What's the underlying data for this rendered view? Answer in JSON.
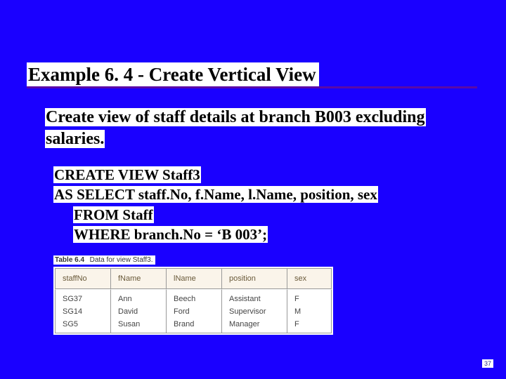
{
  "title": "Example 6. 4 - Create Vertical View",
  "description": "Create view of staff details at branch B003 excluding salaries.",
  "sql": {
    "line1": "CREATE VIEW Staff3",
    "line2": "AS SELECT staff.No, f.Name, l.Name, position, sex",
    "line3": "FROM Staff",
    "line4": "WHERE branch.No = ‘B 003’;"
  },
  "table_caption_bold": "Table 6.4",
  "table_caption_rest": "Data for view Staff3.",
  "chart_data": {
    "type": "table",
    "headers": [
      "staffNo",
      "fName",
      "lName",
      "position",
      "sex"
    ],
    "rows": [
      {
        "staffNo": "SG37",
        "fName": "Ann",
        "lName": "Beech",
        "position": "Assistant",
        "sex": "F"
      },
      {
        "staffNo": "SG14",
        "fName": "David",
        "lName": "Ford",
        "position": "Supervisor",
        "sex": "M"
      },
      {
        "staffNo": "SG5",
        "fName": "Susan",
        "lName": "Brand",
        "position": "Manager",
        "sex": "F"
      }
    ]
  },
  "page_number": "37"
}
